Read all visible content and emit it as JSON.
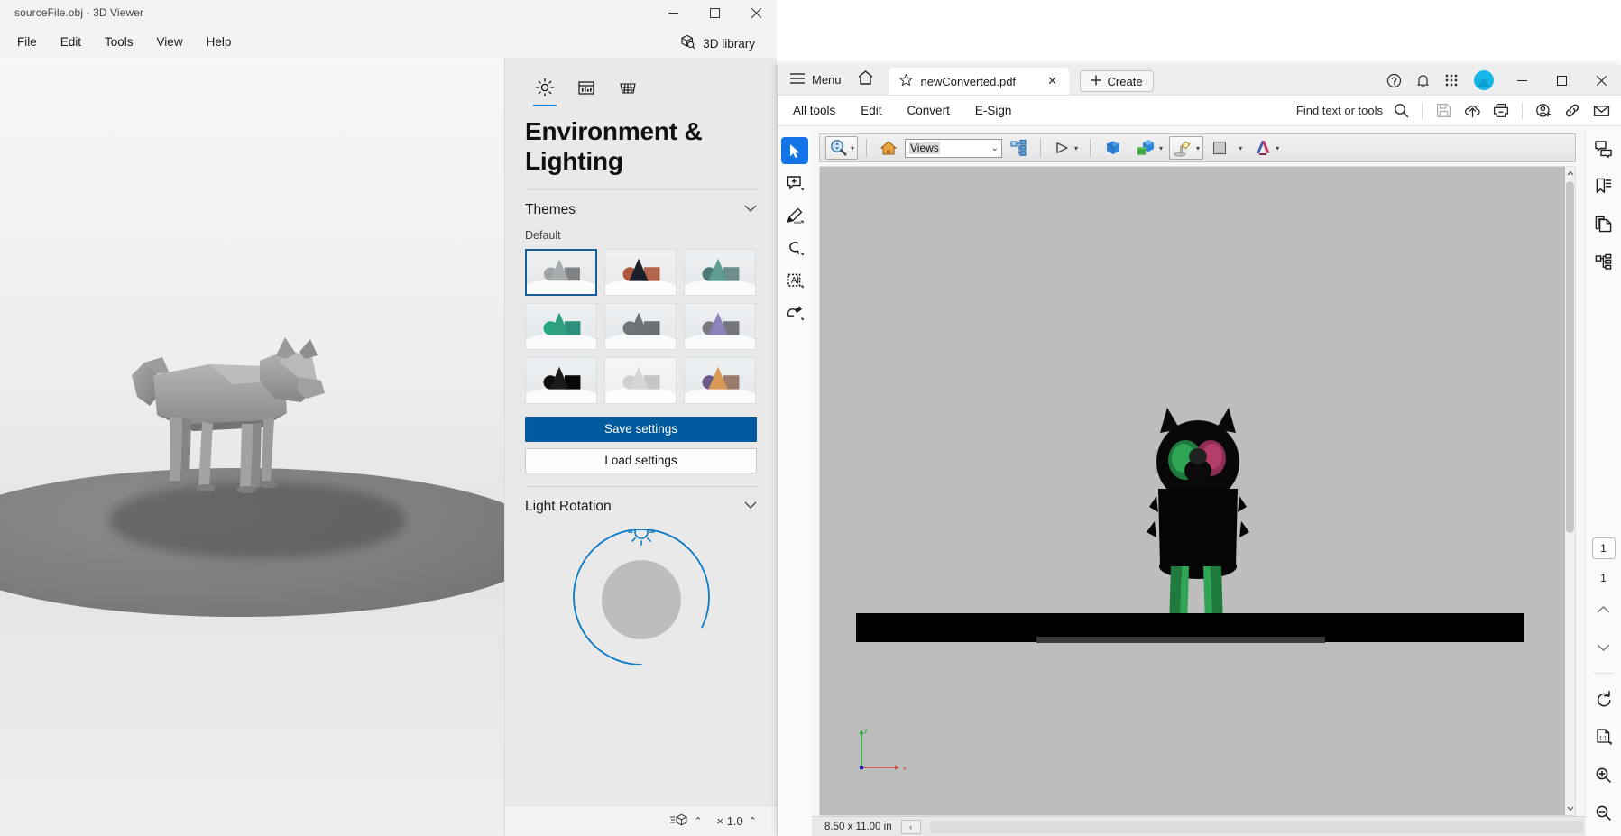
{
  "viewer3d": {
    "title": "sourceFile.obj - 3D Viewer",
    "window_controls": {
      "minimize": "—",
      "maximize": "☐",
      "close": "✕"
    },
    "menu": [
      "File",
      "Edit",
      "Tools",
      "View",
      "Help"
    ],
    "library_button": {
      "label": "3D library",
      "icon": "cube-search-icon"
    },
    "panel": {
      "tabs": [
        {
          "name": "environment-lighting",
          "icon": "sun-icon",
          "active": true
        },
        {
          "name": "view-settings",
          "icon": "panel-icon",
          "active": false
        },
        {
          "name": "grid-settings",
          "icon": "grid-icon",
          "active": false
        }
      ],
      "title": "Environment & Lighting",
      "themes_section": {
        "header": "Themes",
        "chevron": "⌄",
        "sub_label": "Default",
        "selected_index": 0,
        "thumbnails": [
          {
            "name": "theme-default-gray",
            "sphere": "#9fa3a6",
            "cone": "#a9acae",
            "cube": "#7f8385",
            "bg_top": "#eef1f3",
            "bg_bottom": "#e2e5e7",
            "floor": "#fbfbfb"
          },
          {
            "name": "theme-warm-dark",
            "sphere": "#b0583a",
            "cone": "#1c1f2b",
            "cube": "#b2654a",
            "bg_top": "#f0f1f2",
            "bg_bottom": "#e6e8e9",
            "floor": "#fcfcfc"
          },
          {
            "name": "theme-teal-soft",
            "sphere": "#4d7a78",
            "cone": "#5e9d94",
            "cube": "#6f8d8b",
            "bg_top": "#eef1f3",
            "bg_bottom": "#e4e7e9",
            "floor": "#fbfbfb"
          },
          {
            "name": "theme-emerald",
            "sphere": "#24a580",
            "cone": "#2f9f80",
            "cube": "#2f8f7d",
            "bg_top": "#eef1f3",
            "bg_bottom": "#e3e6e8",
            "floor": "#fbfbfb"
          },
          {
            "name": "theme-neutral-gray",
            "sphere": "#6f7478",
            "cone": "#6d7275",
            "cube": "#6b7073",
            "bg_top": "#eef1f3",
            "bg_bottom": "#e3e6e8",
            "floor": "#fbfbfb"
          },
          {
            "name": "theme-violet",
            "sphere": "#79797f",
            "cone": "#8b84ba",
            "cube": "#75757b",
            "bg_top": "#eef1f3",
            "bg_bottom": "#e3e6e8",
            "floor": "#fbfbfb"
          },
          {
            "name": "theme-black",
            "sphere": "#0d0d0d",
            "cone": "#1a1a1a",
            "cube": "#080808",
            "bg_top": "#eef1f3",
            "bg_bottom": "#e3e6e8",
            "floor": "#fbfbfb"
          },
          {
            "name": "theme-light-white",
            "sphere": "#cfcfcf",
            "cone": "#d6d6d6",
            "cube": "#c6c6c6",
            "bg_top": "#f4f6f7",
            "bg_bottom": "#ebeef0",
            "floor": "#fdfdfd"
          },
          {
            "name": "theme-sunset",
            "sphere": "#6a5a86",
            "cone": "#d99a55",
            "cube": "#9a7b6a",
            "bg_top": "#eef1f3",
            "bg_bottom": "#e3e6e8",
            "floor": "#fbfbfb"
          }
        ]
      },
      "save_button": "Save settings",
      "load_button": "Load settings",
      "light_rotation": {
        "header": "Light Rotation",
        "chevron": "⌄",
        "dial_icon": "sun-icon"
      }
    },
    "status_bar": {
      "model_icon": "model-lines-icon",
      "model_chevron": "⌃",
      "zoom_value": "× 1.0",
      "zoom_chevron": "⌃"
    },
    "accent_color": "#0078d4",
    "primary_button_color": "#005a9e"
  },
  "acrobat": {
    "menu_label": "Menu",
    "home_icon": "home-icon",
    "tab": {
      "label": "newConverted.pdf",
      "star_icon": "star-icon",
      "close": "✕"
    },
    "create_button": "Create",
    "titlebar_icons": [
      {
        "name": "help-icon",
        "glyph": "?"
      },
      {
        "name": "notification-bell-icon",
        "glyph": "bell"
      },
      {
        "name": "app-grid-icon",
        "glyph": "grid"
      }
    ],
    "avatar": {
      "name": "user-avatar",
      "color": "#18b5e8"
    },
    "window_controls": {
      "minimize": "—",
      "maximize": "☐",
      "close": "✕"
    },
    "tools": [
      "All tools",
      "Edit",
      "Convert",
      "E-Sign"
    ],
    "find": {
      "label": "Find text or tools",
      "icon": "search-icon"
    },
    "quick_actions": [
      {
        "name": "save-icon",
        "disabled": true
      },
      {
        "name": "cloud-upload-icon",
        "disabled": false
      },
      {
        "name": "print-icon",
        "disabled": false
      },
      {
        "name": "add-person-icon",
        "disabled": false
      },
      {
        "name": "link-icon",
        "disabled": false
      },
      {
        "name": "email-icon",
        "disabled": false
      }
    ],
    "left_tools": [
      {
        "name": "select-tool",
        "active": true
      },
      {
        "name": "add-comment-tool",
        "active": false
      },
      {
        "name": "highlight-tool",
        "active": false
      },
      {
        "name": "draw-lasso-tool",
        "active": false
      },
      {
        "name": "edit-text-tool",
        "active": false
      },
      {
        "name": "stamp-signature-tool",
        "active": false
      }
    ],
    "pdf_3d_toolbar": {
      "rotate_tool": {
        "name": "rotate-zoom-tool",
        "caret": "▾",
        "pressed": false
      },
      "home_view": {
        "name": "default-view-icon"
      },
      "views_select": {
        "value": "Views",
        "caret": "⌄"
      },
      "model_tree": {
        "name": "model-tree-icon"
      },
      "play": {
        "name": "play-animation-icon",
        "caret": "▾"
      },
      "model_render": {
        "name": "solid-render-icon"
      },
      "part_render": {
        "name": "part-render-icon",
        "caret": "▾"
      },
      "lighting": {
        "name": "lighting-icon",
        "caret": "▾",
        "pressed": true
      },
      "background": {
        "name": "background-color-icon",
        "caret": "▾"
      },
      "cross_section": {
        "name": "cross-section-icon",
        "caret": "▾"
      }
    },
    "right_rail": [
      {
        "name": "comments-panel-icon"
      },
      {
        "name": "bookmarks-panel-icon"
      },
      {
        "name": "page-thumbnails-icon"
      },
      {
        "name": "model-tree-panel-icon"
      }
    ],
    "page_nav": {
      "current_page": "1",
      "total_pages": "1",
      "prev_icon": "⌃",
      "next_icon": "⌄"
    },
    "view_tools": [
      {
        "name": "rotate-page-icon"
      },
      {
        "name": "fit-actual-size-icon"
      },
      {
        "name": "zoom-in-icon"
      },
      {
        "name": "zoom-out-icon"
      }
    ],
    "status_bar": {
      "page_size": "8.50 x 11.00 in",
      "collapse": "‹"
    },
    "model_axes": {
      "y_label": "y",
      "x_label": "x",
      "y_color": "#22aa33",
      "x_color": "#d04040"
    }
  }
}
